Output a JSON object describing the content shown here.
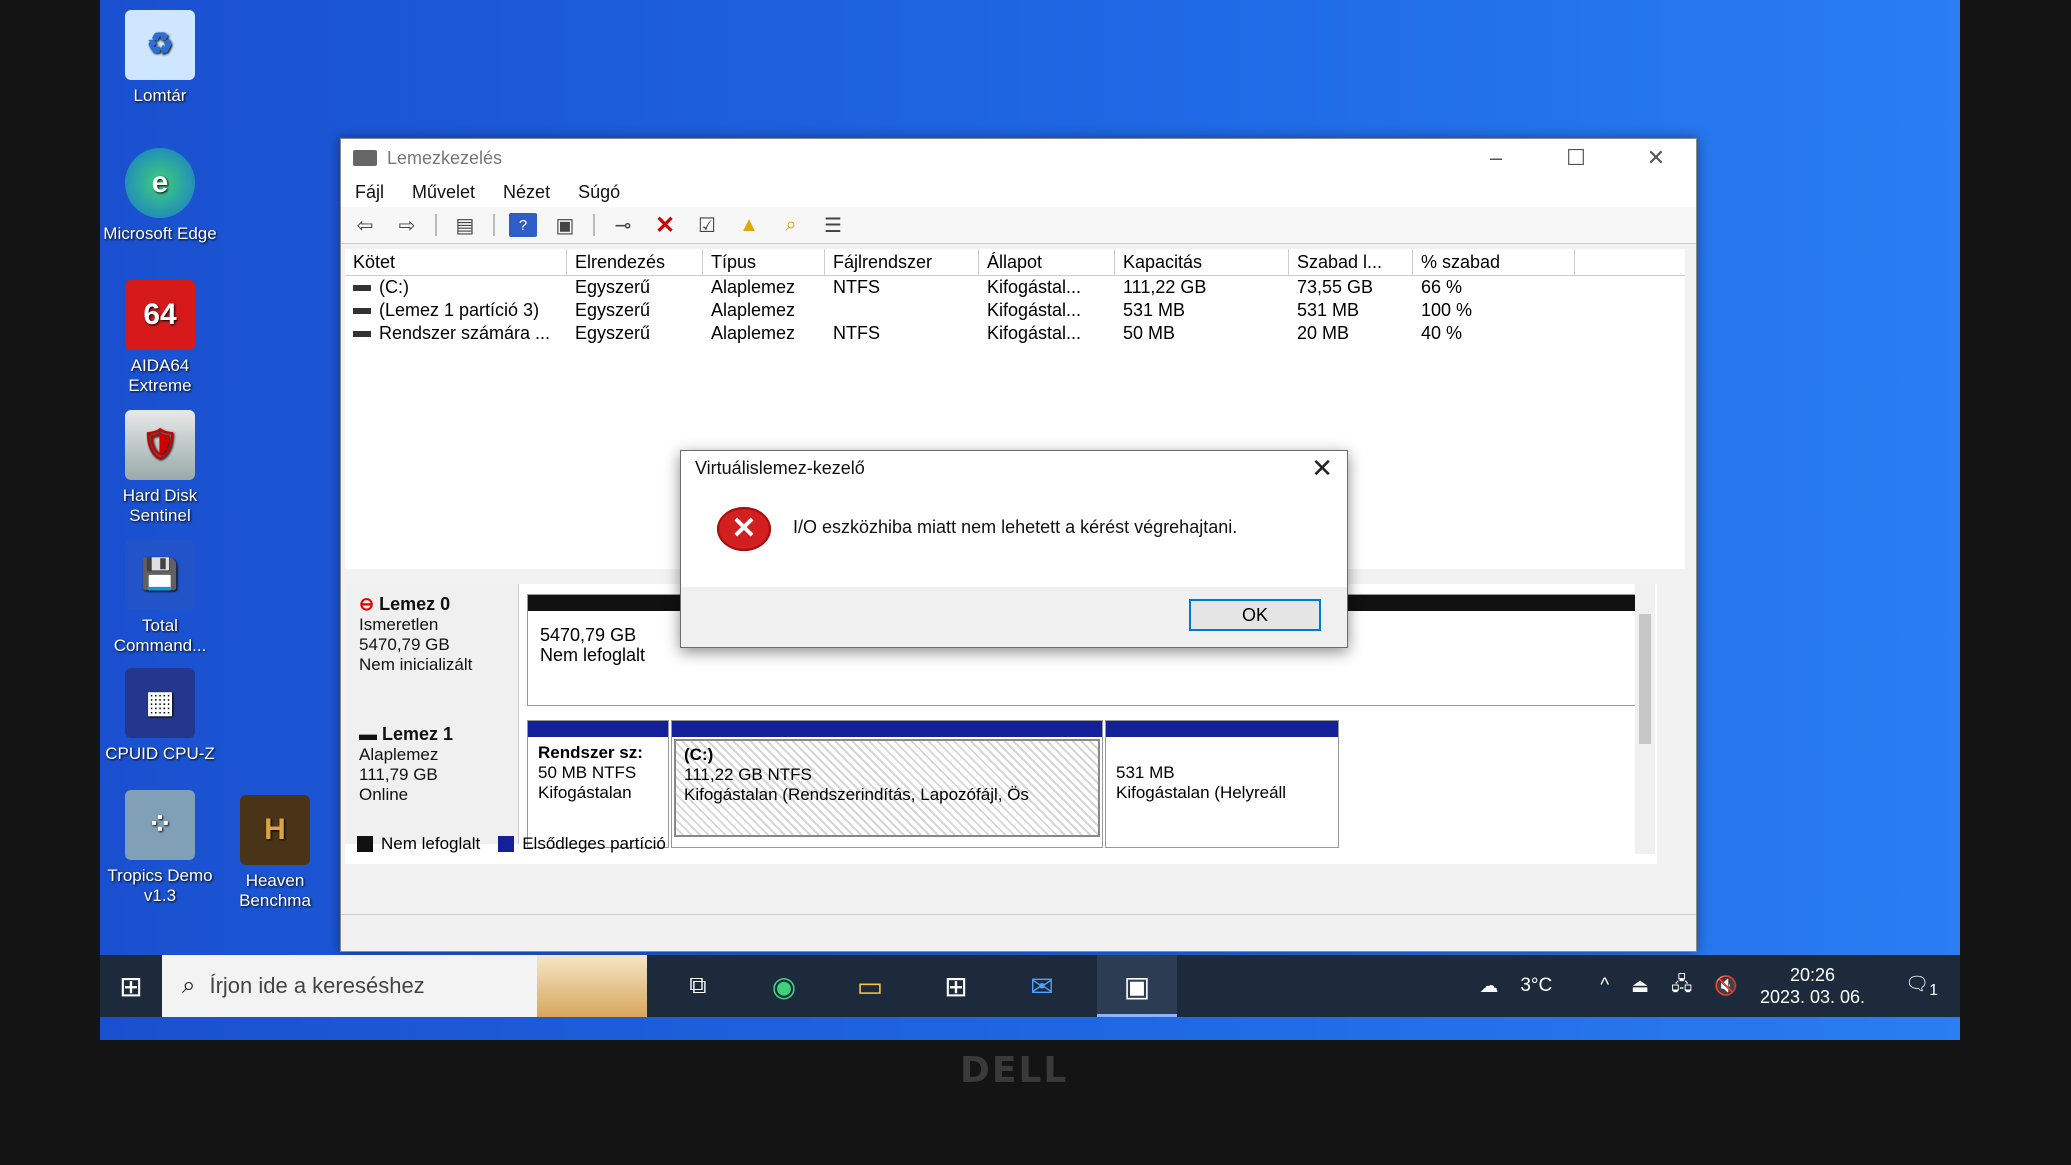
{
  "desktop": {
    "icons": [
      {
        "label": "Lomtár",
        "icon": "recycle-bin-icon"
      },
      {
        "label": "Microsoft Edge",
        "icon": "edge-icon"
      },
      {
        "label": "AIDA64 Extreme",
        "icon": "aida64-icon",
        "glyph": "64"
      },
      {
        "label": "Hard Disk Sentinel",
        "icon": "hdd-sentinel-icon"
      },
      {
        "label": "Total Command...",
        "icon": "total-commander-icon"
      },
      {
        "label": "CPUID CPU-Z",
        "icon": "cpuz-icon"
      },
      {
        "label": "Tropics Demo v1.3",
        "icon": "tropics-icon"
      },
      {
        "label": "Heaven Benchma",
        "icon": "heaven-icon"
      }
    ]
  },
  "window": {
    "title": "Lemezkezelés",
    "menu": [
      "Fájl",
      "Művelet",
      "Nézet",
      "Súgó"
    ],
    "columns": [
      "Kötet",
      "Elrendezés",
      "Típus",
      "Fájlrendszer",
      "Állapot",
      "Kapacitás",
      "Szabad l...",
      "% szabad"
    ],
    "volumes": [
      [
        "(C:)",
        "Egyszerű",
        "Alaplemez",
        "NTFS",
        "Kifogástal...",
        "111,22 GB",
        "73,55 GB",
        "66 %"
      ],
      [
        "(Lemez 1 partíció 3)",
        "Egyszerű",
        "Alaplemez",
        "",
        "Kifogástal...",
        "531 MB",
        "531 MB",
        "100 %"
      ],
      [
        "Rendszer számára ...",
        "Egyszerű",
        "Alaplemez",
        "NTFS",
        "Kifogástal...",
        "50 MB",
        "20 MB",
        "40 %"
      ]
    ],
    "disk0": {
      "name": "Lemez 0",
      "type": "Ismeretlen",
      "size": "5470,79 GB",
      "status": "Nem inicializált",
      "unalloc_size": "5470,79 GB",
      "unalloc_label": "Nem lefoglalt"
    },
    "disk1": {
      "name": "Lemez 1",
      "type": "Alaplemez",
      "size": "111,79 GB",
      "status": "Online",
      "parts": [
        {
          "name": "Rendszer sz:",
          "detail": "50 MB NTFS",
          "status": "Kifogástalan"
        },
        {
          "name": "(C:)",
          "detail": "111,22 GB NTFS",
          "status": "Kifogástalan (Rendszerindítás, Lapozófájl, Ös"
        },
        {
          "name": "",
          "detail": "531 MB",
          "status": "Kifogástalan (Helyreáll"
        }
      ]
    },
    "legend": {
      "unalloc": "Nem lefoglalt",
      "primary": "Elsődleges partíció"
    }
  },
  "dialog": {
    "title": "Virtuálislemez-kezelő",
    "message": "I/O eszközhiba miatt nem lehetett a kérést végrehajtani.",
    "ok": "OK"
  },
  "taskbar": {
    "search_placeholder": "Írjon ide a kereséshez",
    "weather": "3°C",
    "time": "20:26",
    "date": "2023. 03. 06.",
    "notifications": "1"
  },
  "colors": {
    "primary_partition": "#14209a",
    "unallocated": "#111111",
    "desktop": "#1f6ae6",
    "error": "#d21f1f"
  }
}
